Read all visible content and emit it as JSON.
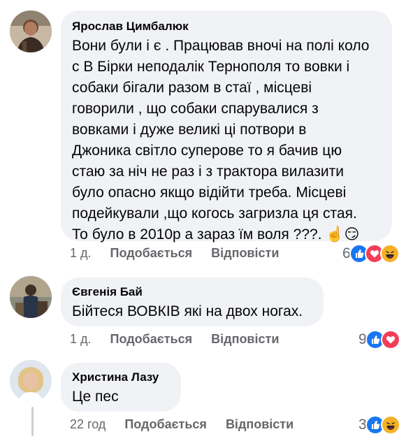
{
  "comments": [
    {
      "author": "Ярослав Цимбалюк",
      "lines": [
        "Вони були і є . Працював вночі на полі коло",
        "с В Бірки неподалік Тернополя то вовки і",
        "собаки бігали разом в стаї , місцеві",
        "говорили , що собаки спарувалися з",
        "вовками і дуже  великі ці потвори в",
        "Джоника світло суперове то я бачив цю",
        "стаю за ніч не раз і з трактора вилазити",
        "було опасно якщо відійти треба. Місцеві",
        "подейкували ,що когось загризла ця стая.",
        "То було в 2010р а зараз їм воля ???."
      ],
      "emojis": "☝️😏",
      "time": "1 д.",
      "like_label": "Подобається",
      "reply_label": "Відповісти",
      "reaction_count": "6",
      "reactions": [
        "like-icon",
        "love-icon",
        "haha-icon"
      ]
    },
    {
      "author": "Євгенія Бай",
      "lines": [
        "Бійтеся ВОВКІВ які на двох ногах."
      ],
      "time": "1 д.",
      "like_label": "Подобається",
      "reply_label": "Відповісти",
      "reaction_count": "9",
      "reactions": [
        "like-icon",
        "love-icon"
      ]
    },
    {
      "author": "Христина Лазу",
      "lines": [
        "Це пес"
      ],
      "time": "22 год",
      "like_label": "Подобається",
      "reply_label": "Відповісти",
      "reaction_count": "3",
      "reactions": [
        "like-icon",
        "haha-icon"
      ]
    }
  ],
  "colors": {
    "bubble": "#f0f2f5",
    "meta_text": "#65676b",
    "like": "#1877f2",
    "love": "#f33e58",
    "haha": "#f7b125"
  }
}
